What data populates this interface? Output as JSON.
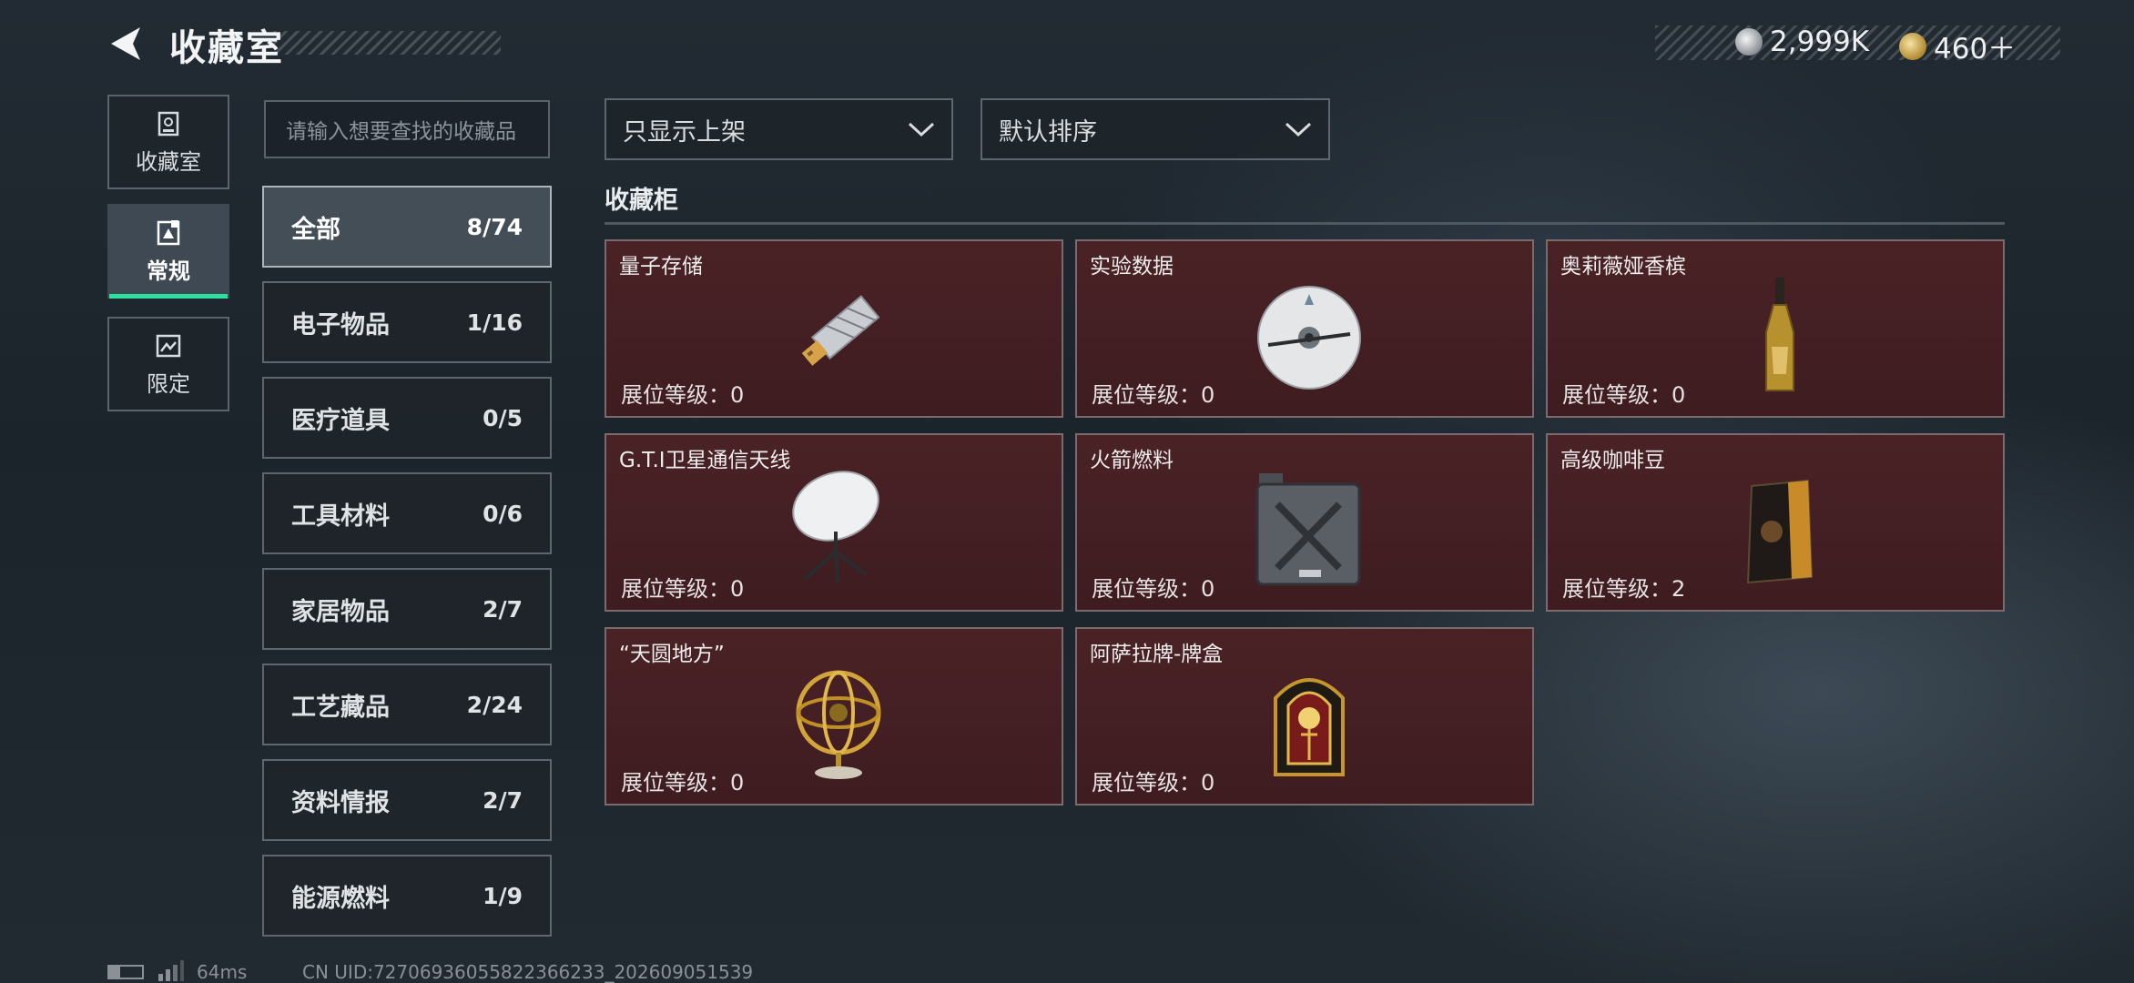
{
  "header": {
    "title": "收藏室"
  },
  "currency": [
    {
      "icon": "silver-coin-icon",
      "value": "2,999K"
    },
    {
      "icon": "gold-coin-icon",
      "value": "460＋"
    }
  ],
  "side_nav": [
    {
      "label": "收藏室",
      "icon": "collection-room-icon"
    },
    {
      "label": "常规",
      "icon": "regular-icon",
      "active": true
    },
    {
      "label": "限定",
      "icon": "limited-icon"
    }
  ],
  "search": {
    "placeholder": "请输入想要查找的收藏品"
  },
  "categories": [
    {
      "name": "全部",
      "count": "8/74",
      "active": true
    },
    {
      "name": "电子物品",
      "count": "1/16"
    },
    {
      "name": "医疗道具",
      "count": "0/5"
    },
    {
      "name": "工具材料",
      "count": "0/6"
    },
    {
      "name": "家居物品",
      "count": "2/7"
    },
    {
      "name": "工艺藏品",
      "count": "2/24"
    },
    {
      "name": "资料情报",
      "count": "2/7"
    },
    {
      "name": "能源燃料",
      "count": "1/9"
    }
  ],
  "filters": {
    "display": "只显示上架",
    "sort": "默认排序"
  },
  "section": {
    "title": "收藏柜"
  },
  "items": [
    {
      "name": "量子存储",
      "level": "展位等级：0",
      "icon": "usb-drive-icon"
    },
    {
      "name": "实验数据",
      "level": "展位等级：0",
      "icon": "disc-icon"
    },
    {
      "name": "奥莉薇娅香槟",
      "level": "展位等级：0",
      "icon": "champagne-bottle-icon"
    },
    {
      "name": "G.T.I卫星通信天线",
      "level": "展位等级：0",
      "icon": "satellite-dish-icon"
    },
    {
      "name": "火箭燃料",
      "level": "展位等级：0",
      "icon": "fuel-canister-icon"
    },
    {
      "name": "高级咖啡豆",
      "level": "展位等级：2",
      "icon": "coffee-bag-icon"
    },
    {
      "name": "“天圆地方”",
      "level": "展位等级：0",
      "icon": "armillary-sphere-icon"
    },
    {
      "name": "阿萨拉牌-牌盒",
      "level": "展位等级：0",
      "icon": "card-box-icon"
    }
  ],
  "status_bar": {
    "ping": "64ms",
    "uid": "CN UID:72706936055822366233_202609051539"
  },
  "colors": {
    "accent": "#2fe0a0",
    "card_bg": "#3e1c20"
  }
}
